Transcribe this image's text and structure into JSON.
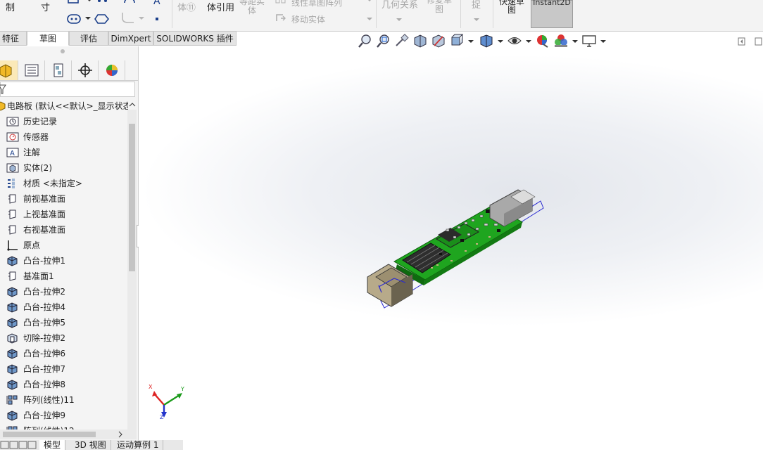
{
  "ribbon": {
    "items": [
      {
        "label": "制"
      },
      {
        "label": "寸"
      },
      {
        "label": "体⑪",
        "disabled": true
      },
      {
        "label": "体引用"
      },
      {
        "label": "等距实\n体",
        "disabled": true
      },
      {
        "label": "线性草图阵列",
        "disabled": true
      },
      {
        "label": "移动实体",
        "disabled": true
      },
      {
        "label": "几何关系",
        "disabled": true
      },
      {
        "label": "修复草\n图",
        "disabled": true
      },
      {
        "label": "捉",
        "disabled": true
      }
    ],
    "quick_snap": "快速草\n图",
    "instant2d": "Instant2D"
  },
  "command_tabs": [
    "特征",
    "草图",
    "评估",
    "DimXpert",
    "SOLIDWORKS 插件"
  ],
  "active_command_tab": "草图",
  "heads_up_icons": [
    "zoom-to-fit-icon",
    "zoom-to-area-icon",
    "previous-view-icon",
    "section-view-icon",
    "dynamic-annotation-icon",
    "view-orientation-icon",
    "display-style-icon",
    "hide-show-icon",
    "edit-appearance-icon",
    "apply-scene-icon",
    "view-settings-icon"
  ],
  "panel_tabs": [
    "featuremanager-icon",
    "propertymanager-icon",
    "configurationmanager-icon",
    "dimxpert-icon",
    "display-manager-icon"
  ],
  "tree": {
    "root": "电路板  (默认<<默认>_显示状态",
    "items": [
      {
        "label": "历史记录",
        "icon": "history-icon"
      },
      {
        "label": "传感器",
        "icon": "sensor-icon"
      },
      {
        "label": "注解",
        "icon": "annotation-icon"
      },
      {
        "label": "实体(2)",
        "icon": "solid-bodies-icon"
      },
      {
        "label": "材质 <未指定>",
        "icon": "material-icon"
      },
      {
        "label": "前视基准面",
        "icon": "plane-icon"
      },
      {
        "label": "上视基准面",
        "icon": "plane-icon"
      },
      {
        "label": "右视基准面",
        "icon": "plane-icon"
      },
      {
        "label": "原点",
        "icon": "origin-icon"
      },
      {
        "label": "凸台-拉伸1",
        "icon": "extrude-icon"
      },
      {
        "label": "基准面1",
        "icon": "plane-icon"
      },
      {
        "label": "凸台-拉伸2",
        "icon": "extrude-icon"
      },
      {
        "label": "凸台-拉伸4",
        "icon": "extrude-icon"
      },
      {
        "label": "凸台-拉伸5",
        "icon": "extrude-icon"
      },
      {
        "label": "切除-拉伸2",
        "icon": "cut-extrude-icon"
      },
      {
        "label": "凸台-拉伸6",
        "icon": "extrude-icon"
      },
      {
        "label": "凸台-拉伸7",
        "icon": "extrude-icon"
      },
      {
        "label": "凸台-拉伸8",
        "icon": "extrude-icon"
      },
      {
        "label": "阵列(线性)11",
        "icon": "linear-pattern-icon"
      },
      {
        "label": "凸台-拉伸9",
        "icon": "extrude-icon"
      },
      {
        "label": "阵列(线性)12",
        "icon": "linear-pattern-icon"
      }
    ]
  },
  "bottom_tabs": [
    "模型",
    "3D 视图",
    "运动算例 1"
  ],
  "active_bottom_tab": "模型",
  "triad": {
    "x": "X",
    "y": "Y",
    "z": "Z"
  },
  "colors": {
    "pcb": "#1fa51f",
    "heatsink": "#2e2e2e",
    "connector": "#9b9b9b",
    "sketch": "#2b2bd0"
  }
}
